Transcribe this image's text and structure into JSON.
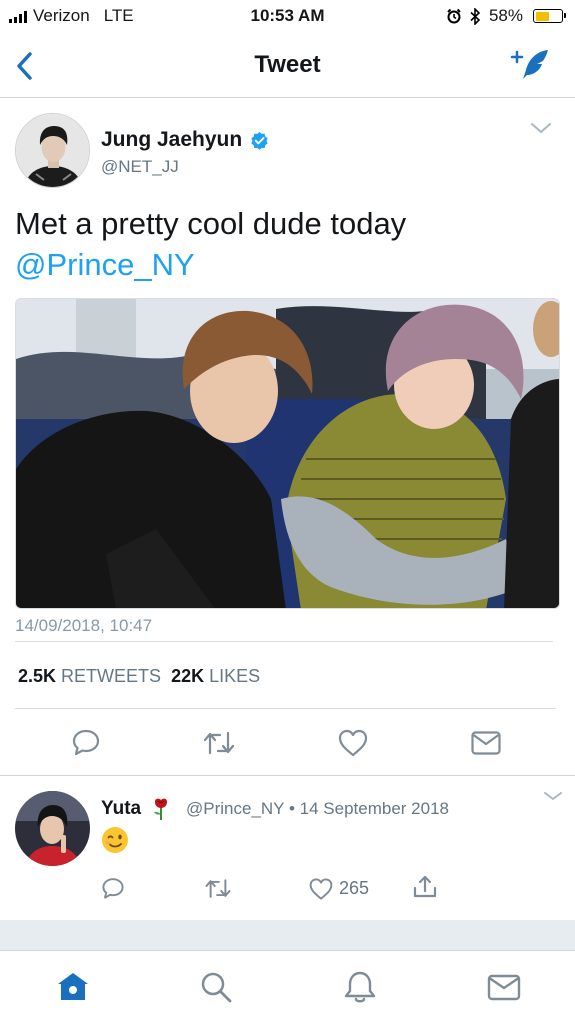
{
  "status_bar": {
    "carrier": "Verizon",
    "network": "LTE",
    "time": "10:53 AM",
    "battery_percent": "58%",
    "battery_level": 0.58
  },
  "nav": {
    "title": "Tweet",
    "back_icon": "chevron-left-icon",
    "compose_icon": "compose-feather-icon"
  },
  "tweet": {
    "author_name": "Jung Jaehyun",
    "verified": true,
    "author_handle": "@NET_JJ",
    "text": "Met a pretty cool dude today",
    "mention": "@Prince_NY",
    "timestamp": "14/09/2018, 10:47",
    "retweets_count": "2.5K",
    "retweets_label": "RETWEETS",
    "likes_count": "22K",
    "likes_label": "LIKES"
  },
  "reply": {
    "author_name": "Yuta",
    "author_handle": "@Prince_NY",
    "separator": "•",
    "date": "14 September 2018",
    "emoji": "wink-emoji",
    "like_count": "265"
  },
  "tabbar": {
    "items": [
      "home-icon",
      "search-icon",
      "notifications-bell-icon",
      "messages-envelope-icon"
    ]
  },
  "colors": {
    "accent": "#1da1f2",
    "nav_icon": "#1b6fbf",
    "secondary_text": "#657786",
    "icon_gray": "#7f8c97"
  }
}
